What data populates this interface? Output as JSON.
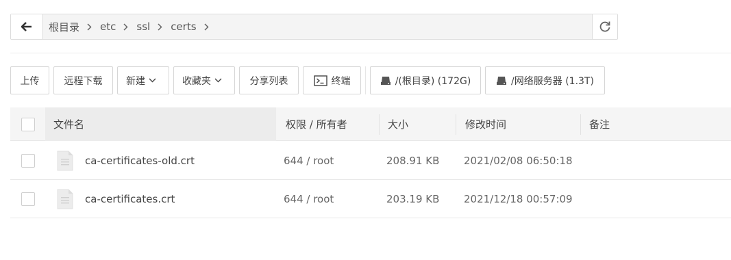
{
  "pathbar": {
    "back_icon": "arrow-left-icon",
    "crumbs": [
      "根目录",
      "etc",
      "ssl",
      "certs"
    ],
    "refresh_icon": "refresh-icon"
  },
  "toolbar": {
    "upload": "上传",
    "remote_download": "远程下载",
    "new": "新建",
    "favorites": "收藏夹",
    "share_list": "分享列表",
    "terminal": "终端",
    "disk_root": "/(根目录) (172G)",
    "disk_net": "/网络服务器 (1.3T)"
  },
  "table": {
    "headers": {
      "name": "文件名",
      "perm_owner": "权限 / 所有者",
      "size": "大小",
      "modified": "修改时间",
      "note": "备注"
    },
    "rows": [
      {
        "name": "ca-certificates-old.crt",
        "perm": "644 / root",
        "size": "208.91 KB",
        "modified": "2021/02/08 06:50:18",
        "note": ""
      },
      {
        "name": "ca-certificates.crt",
        "perm": "644 / root",
        "size": "203.19 KB",
        "modified": "2021/12/18 00:57:09",
        "note": ""
      }
    ]
  }
}
